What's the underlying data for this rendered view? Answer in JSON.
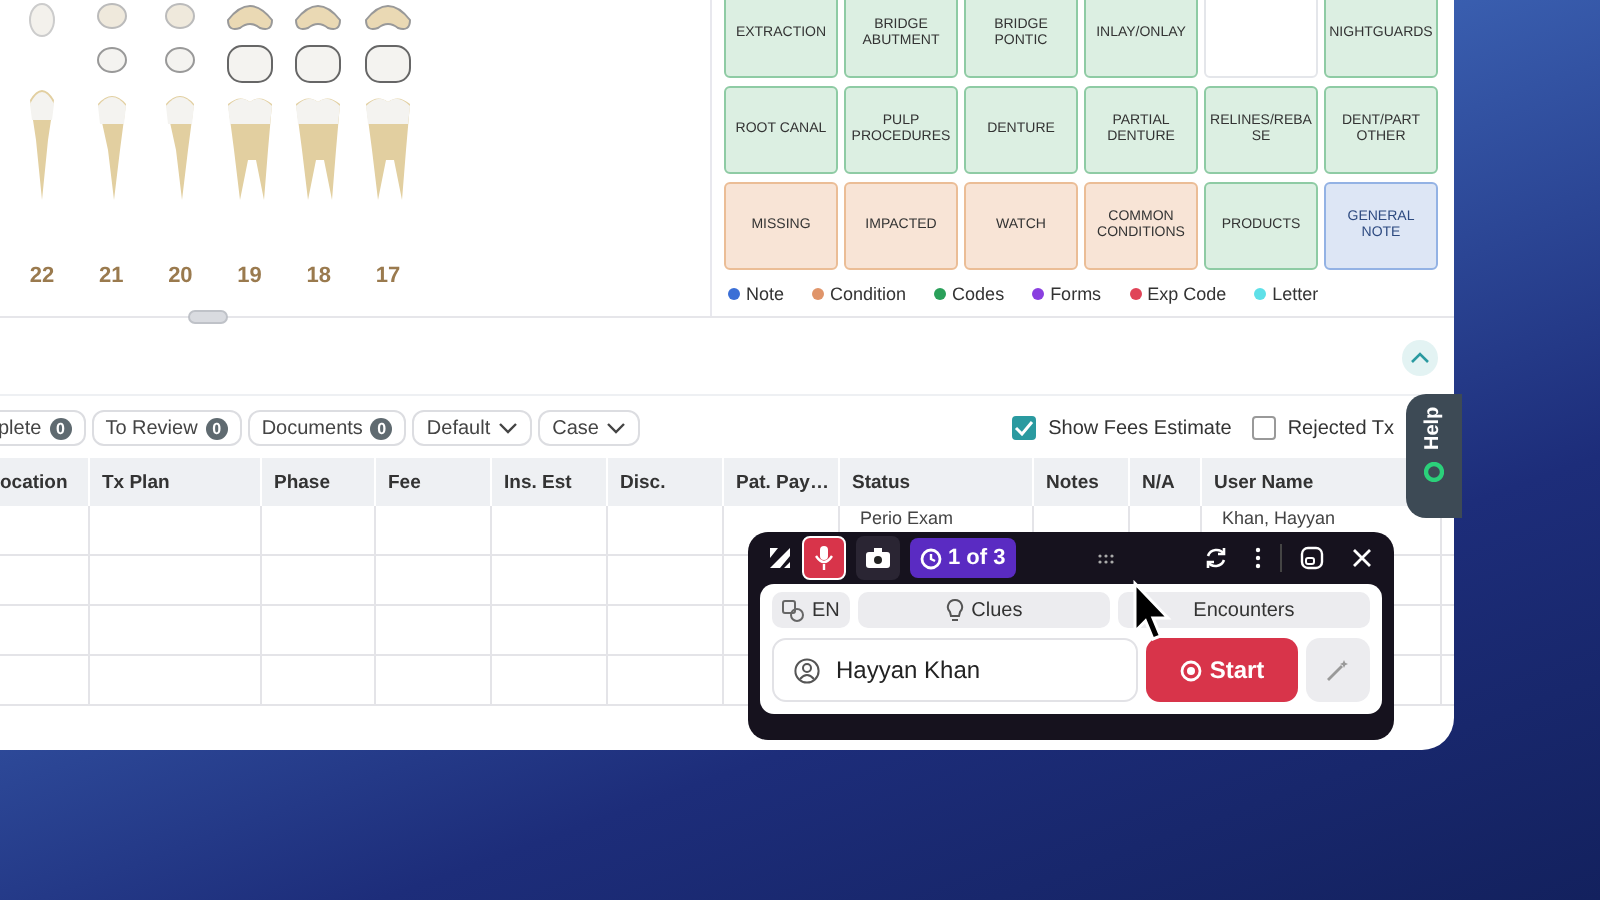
{
  "teeth": [
    {
      "number": "22",
      "kind": "canine"
    },
    {
      "number": "21",
      "kind": "premolar"
    },
    {
      "number": "20",
      "kind": "premolar"
    },
    {
      "number": "19",
      "kind": "molar"
    },
    {
      "number": "18",
      "kind": "molar"
    },
    {
      "number": "17",
      "kind": "molar"
    }
  ],
  "code_buttons": [
    {
      "label": "EXTRACTION",
      "kind": "codes"
    },
    {
      "label": "BRIDGE ABUTMENT",
      "kind": "codes"
    },
    {
      "label": "BRIDGE PONTIC",
      "kind": "codes"
    },
    {
      "label": "INLAY/ONLAY",
      "kind": "codes"
    },
    {
      "kind": "blank"
    },
    {
      "label": "NIGHTGUARDS",
      "kind": "codes"
    },
    {
      "label": "ROOT CANAL",
      "kind": "codes"
    },
    {
      "label": "PULP PROCEDURES",
      "kind": "codes"
    },
    {
      "label": "DENTURE",
      "kind": "codes"
    },
    {
      "label": "PARTIAL DENTURE",
      "kind": "codes"
    },
    {
      "label": "RELINES/REBASE",
      "kind": "codes"
    },
    {
      "label": "DENT/PART OTHER",
      "kind": "codes"
    },
    {
      "label": "MISSING",
      "kind": "condition"
    },
    {
      "label": "IMPACTED",
      "kind": "condition"
    },
    {
      "label": "WATCH",
      "kind": "condition"
    },
    {
      "label": "COMMON CONDITIONS",
      "kind": "condition"
    },
    {
      "label": "PRODUCTS",
      "kind": "codes"
    },
    {
      "label": "GENERAL NOTE",
      "kind": "note"
    }
  ],
  "legend": [
    {
      "label": "Note",
      "color": "#3b6fd6"
    },
    {
      "label": "Condition",
      "color": "#e0956a"
    },
    {
      "label": "Codes",
      "color": "#2aa05a"
    },
    {
      "label": "Forms",
      "color": "#8a3fe0"
    },
    {
      "label": "Exp Code",
      "color": "#e04458"
    },
    {
      "label": "Letter",
      "color": "#5ee0e8"
    }
  ],
  "filters": [
    {
      "label": "plete",
      "count": "0",
      "kind": "counter"
    },
    {
      "label": "To Review",
      "count": "0",
      "kind": "counter"
    },
    {
      "label": "Documents",
      "count": "0",
      "kind": "counter"
    },
    {
      "label": "Default",
      "kind": "dropdown"
    },
    {
      "label": "Case",
      "kind": "dropdown"
    }
  ],
  "options": [
    {
      "label": "Show Fees Estimate",
      "checked": true
    },
    {
      "label": "Rejected Tx",
      "checked": false
    }
  ],
  "table": {
    "columns": [
      "ocation",
      "Tx Plan",
      "Phase",
      "Fee",
      "Ins. Est",
      "Disc.",
      "Pat. Pay…",
      "Status",
      "Notes",
      "N/A",
      "User Name"
    ],
    "rows": [
      [
        "",
        "",
        "",
        "",
        "",
        "",
        "",
        "Perio Exam",
        "",
        "",
        "Khan, Hayyan"
      ],
      [
        "",
        "",
        "",
        "",
        "",
        "",
        "",
        "",
        "",
        "",
        ""
      ],
      [
        "",
        "",
        "",
        "",
        "",
        "",
        "",
        "",
        "",
        "",
        ""
      ],
      [
        "",
        "",
        "",
        "",
        "",
        "",
        "",
        "",
        "",
        "",
        ""
      ]
    ]
  },
  "help_tab": {
    "label": "Help"
  },
  "assistant": {
    "recording": true,
    "counter": "1 of 3",
    "language": "EN",
    "tabs": [
      "Clues",
      "Encounters"
    ],
    "patient": "Hayyan Khan",
    "start_label": "Start"
  }
}
